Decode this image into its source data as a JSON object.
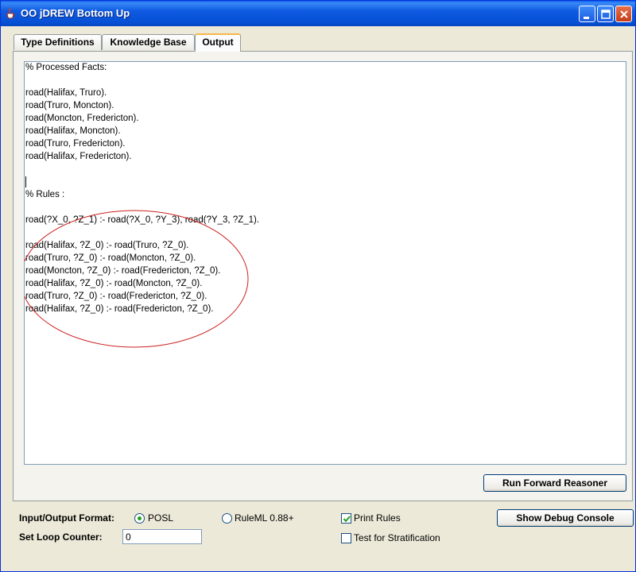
{
  "window": {
    "title": "OO jDREW Bottom Up"
  },
  "tabs": [
    {
      "label": "Type Definitions"
    },
    {
      "label": "Knowledge Base"
    },
    {
      "label": "Output"
    }
  ],
  "output": {
    "lines": [
      "% Processed Facts:",
      "",
      "road(Halifax, Truro).",
      "road(Truro, Moncton).",
      "road(Moncton, Fredericton).",
      "road(Halifax, Moncton).",
      "road(Truro, Fredericton).",
      "road(Halifax, Fredericton).",
      "",
      "",
      "% Rules :",
      "",
      "road(?X_0, ?Z_1) :- road(?X_0, ?Y_3), road(?Y_3, ?Z_1).",
      "",
      "road(Halifax, ?Z_0) :- road(Truro, ?Z_0).",
      "road(Truro, ?Z_0) :- road(Moncton, ?Z_0).",
      "road(Moncton, ?Z_0) :- road(Fredericton, ?Z_0).",
      "road(Halifax, ?Z_0) :- road(Moncton, ?Z_0).",
      "road(Truro, ?Z_0) :- road(Fredericton, ?Z_0).",
      "road(Halifax, ?Z_0) :- road(Fredericton, ?Z_0)."
    ],
    "annotation_color": "#cc2020"
  },
  "buttons": {
    "run_forward": "Run Forward Reasoner",
    "show_debug": "Show Debug Console"
  },
  "options": {
    "format_label": "Input/Output Format:",
    "posl_label": "POSL",
    "ruleml_label": "RuleML 0.88+",
    "selected_format": "POSL",
    "print_rules_label": "Print Rules",
    "print_rules_checked": true,
    "stratification_label": "Test for Stratification",
    "stratification_checked": false,
    "loop_counter_label": "Set Loop Counter:",
    "loop_counter_value": "0"
  }
}
